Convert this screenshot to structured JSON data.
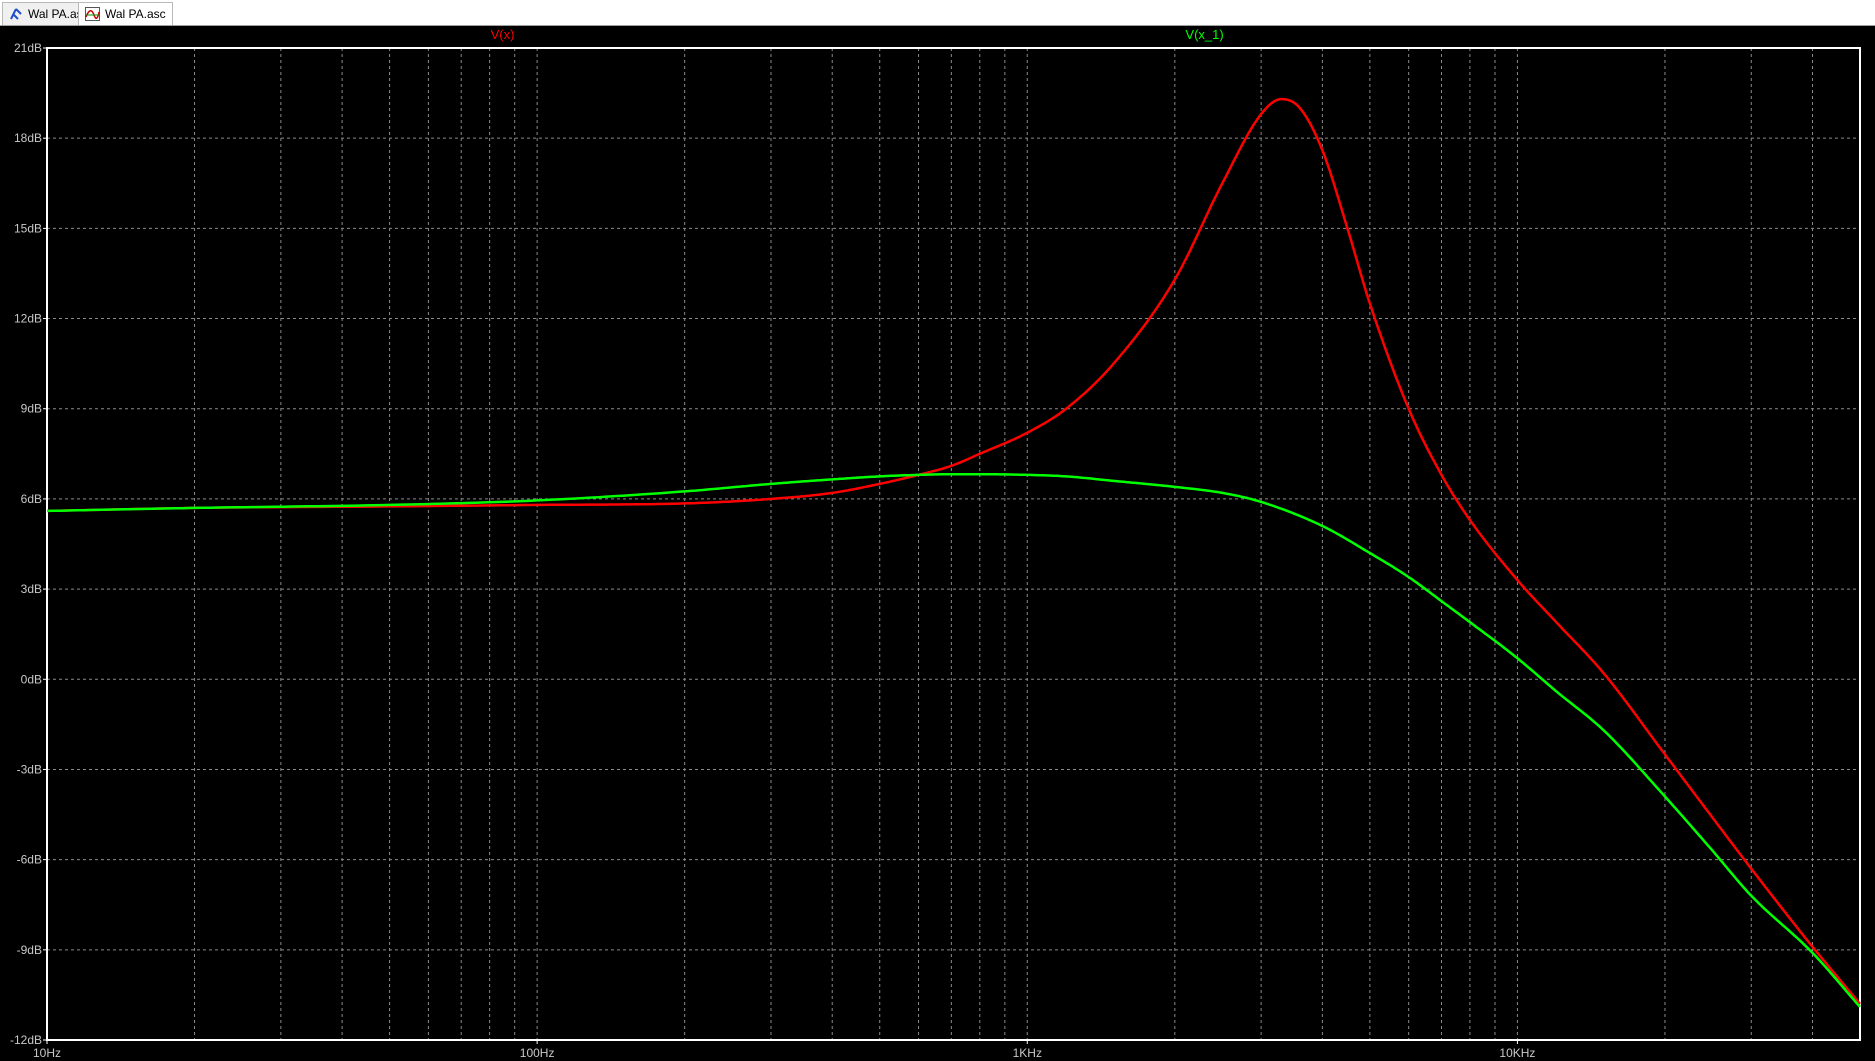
{
  "tabs": [
    {
      "label": "Wal PA.asc",
      "icon": "schematic-icon",
      "active": false
    },
    {
      "label": "Wal PA.asc",
      "icon": "waveform-icon",
      "active": true
    }
  ],
  "chart_data": {
    "type": "line",
    "xscale": "log",
    "xlim": [
      10,
      50000
    ],
    "ylim": [
      -12,
      21
    ],
    "grid": true,
    "background": "#000000",
    "grid_color": "#8a8a8a",
    "x_ticks": [
      {
        "value": 10,
        "label": "10Hz"
      },
      {
        "value": 100,
        "label": "100Hz"
      },
      {
        "value": 1000,
        "label": "1KHz"
      },
      {
        "value": 10000,
        "label": "10KHz"
      }
    ],
    "y_ticks": [
      {
        "value": 21,
        "label": "21dB"
      },
      {
        "value": 18,
        "label": "18dB"
      },
      {
        "value": 15,
        "label": "15dB"
      },
      {
        "value": 12,
        "label": "12dB"
      },
      {
        "value": 9,
        "label": "9dB"
      },
      {
        "value": 6,
        "label": "6dB"
      },
      {
        "value": 3,
        "label": "3dB"
      },
      {
        "value": 0,
        "label": "0dB"
      },
      {
        "value": -3,
        "label": "-3dB"
      },
      {
        "value": -6,
        "label": "-6dB"
      },
      {
        "value": -9,
        "label": "-9dB"
      },
      {
        "value": -12,
        "label": "-12dB"
      }
    ],
    "series": [
      {
        "name": "V(x)",
        "color": "#ff0000",
        "x": [
          10,
          20,
          50,
          100,
          200,
          300,
          400,
          500,
          600,
          700,
          800,
          1000,
          1200,
          1500,
          2000,
          2500,
          3000,
          3300,
          3600,
          4000,
          4500,
          5000,
          6000,
          7000,
          8000,
          10000,
          12000,
          15000,
          20000,
          25000,
          30000,
          40000,
          50000
        ],
        "y": [
          5.6,
          5.7,
          5.75,
          5.8,
          5.85,
          6.0,
          6.2,
          6.5,
          6.8,
          7.1,
          7.5,
          8.2,
          9.0,
          10.5,
          13.3,
          16.5,
          18.8,
          19.3,
          19.0,
          17.6,
          15.0,
          12.5,
          9.0,
          6.8,
          5.3,
          3.3,
          1.9,
          0.2,
          -2.5,
          -4.6,
          -6.3,
          -8.9,
          -10.8
        ]
      },
      {
        "name": "V(x_1)",
        "color": "#00ff00",
        "x": [
          10,
          20,
          50,
          100,
          200,
          300,
          400,
          500,
          600,
          700,
          800,
          1000,
          1200,
          1500,
          2000,
          2500,
          3000,
          4000,
          5000,
          6000,
          7000,
          8000,
          10000,
          12000,
          15000,
          20000,
          25000,
          30000,
          40000,
          50000
        ],
        "y": [
          5.6,
          5.7,
          5.8,
          5.95,
          6.25,
          6.5,
          6.65,
          6.75,
          6.8,
          6.82,
          6.82,
          6.8,
          6.75,
          6.6,
          6.4,
          6.2,
          5.9,
          5.1,
          4.2,
          3.4,
          2.6,
          1.9,
          0.7,
          -0.4,
          -1.7,
          -3.9,
          -5.7,
          -7.2,
          -9.1,
          -10.9
        ]
      }
    ]
  }
}
